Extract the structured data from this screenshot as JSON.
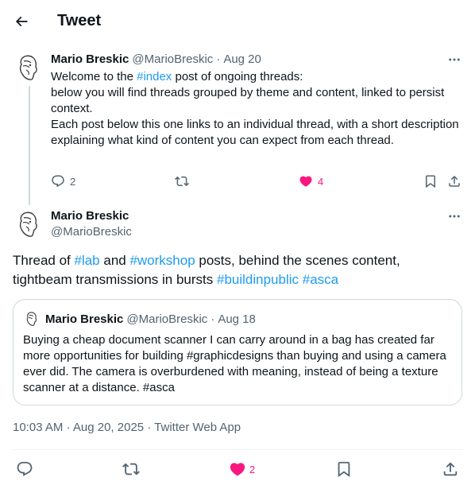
{
  "header": {
    "title": "Tweet"
  },
  "parent_tweet": {
    "author_name": "Mario Breskic",
    "handle": "@MarioBreskic",
    "separator": "·",
    "date": "Aug 20",
    "text_line1_before": "Welcome to the ",
    "hashtag_index": "#index",
    "text_line1_after": " post of ongoing threads:",
    "text_line2": "below you will find threads grouped by theme and content, linked to persist context.",
    "text_line3": "Each post below this one links to an individual thread, with a short description explaining what kind of content you can expect from each thread.",
    "reply_count": "2",
    "like_count": "4"
  },
  "main_tweet": {
    "author_name": "Mario Breskic",
    "handle": "@MarioBreskic",
    "text_1": "Thread of ",
    "hashtag_lab": "#lab",
    "text_2": " and ",
    "hashtag_workshop": "#workshop",
    "text_3": " posts, behind the scenes content, tightbeam transmissions in bursts ",
    "hashtag_buildinpublic": "#buildinpublic",
    "hashtag_asca": "#asca",
    "timestamp": "10:03 AM · Aug 20, 2025 · Twitter Web App",
    "like_count": "2"
  },
  "quoted_tweet": {
    "author_name": "Mario Breskic",
    "handle": "@MarioBreskic",
    "separator": "·",
    "date": "Aug 18",
    "text": "Buying a cheap document scanner I can carry around in a bag has created far more opportunities for building #graphicdesigns than buying and using a camera ever did. The camera is overburdened with meaning, instead of being a texture scanner at a distance. #asca"
  },
  "icons": {
    "back": "arrow-left-icon",
    "more": "more-horizontal-icon",
    "reply": "reply-icon",
    "retweet": "retweet-icon",
    "like": "heart-filled-icon",
    "bookmark": "bookmark-icon",
    "share": "share-icon"
  },
  "colors": {
    "link": "#1d9bf0",
    "like": "#f91880",
    "muted": "#536471",
    "text": "#0f1419",
    "border": "#cfd9de"
  }
}
